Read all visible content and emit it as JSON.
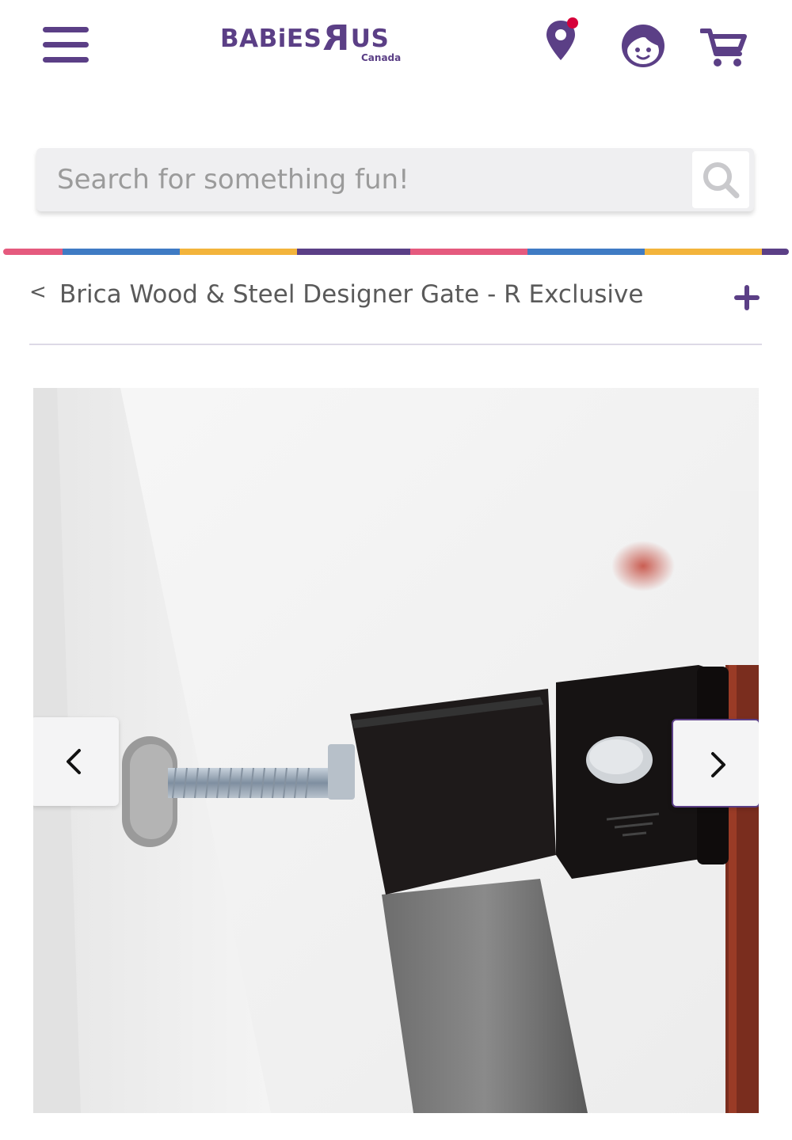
{
  "header": {
    "menu_icon": "hamburger-menu-icon",
    "logo": {
      "main_left": "BABiES",
      "main_right": "US",
      "sub": "Canada"
    },
    "icons": [
      "location-pin-icon",
      "account-face-icon",
      "shopping-cart-icon"
    ],
    "brand_color": "#5b3f86",
    "notification_dot_color": "#d6003a"
  },
  "search": {
    "placeholder": "Search for something fun!",
    "value": "",
    "icon": "search-icon"
  },
  "divider_colors": [
    "#e55a7e",
    "#3f7bc4",
    "#f3b43b",
    "#5b3f86",
    "#e55a7e",
    "#3f7bc4",
    "#f3b43b",
    "#5b3f86"
  ],
  "breadcrumb": {
    "back_label": "<",
    "title": "Brica Wood & Steel Designer Gate - R Exclusive",
    "expand_icon": "plus-icon"
  },
  "gallery": {
    "image": "product-photo-gate-mount-closeup",
    "prev_icon": "chevron-left-icon",
    "next_icon": "chevron-right-icon"
  }
}
